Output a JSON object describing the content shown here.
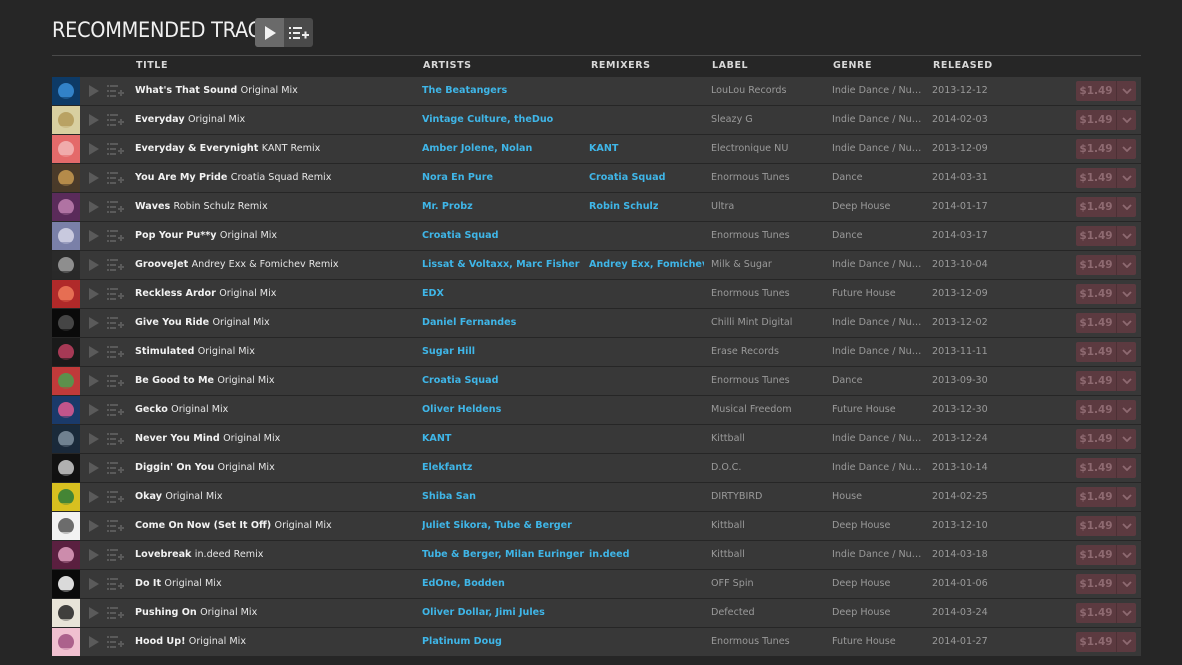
{
  "section": {
    "title": "RECOMMENDED TRACKS"
  },
  "header_buttons": {
    "play_all": "play-icon",
    "add_all_to_queue": "add-to-queue-icon"
  },
  "columns": {
    "title": "TITLE",
    "artists": "ARTISTS",
    "remixers": "REMIXERS",
    "label": "LABEL",
    "genre": "GENRE",
    "released": "RELEASED"
  },
  "colors": {
    "background": "#262626",
    "row": "#383838",
    "link": "#3fb6e8",
    "price_button": "#5c3a40",
    "price_text": "#8e6a71"
  },
  "tracks": [
    {
      "name": "What's That Sound",
      "mix": "Original Mix",
      "artists": "The Beatangers",
      "remixers": "",
      "label": "LouLou Records",
      "genre": "Indie Dance / Nu Disco",
      "released": "2013-12-12",
      "price": "$1.49"
    },
    {
      "name": "Everyday",
      "mix": "Original Mix",
      "artists": "Vintage Culture, theDuo",
      "remixers": "",
      "label": "Sleazy G",
      "genre": "Indie Dance / Nu Disco",
      "released": "2014-02-03",
      "price": "$1.49"
    },
    {
      "name": "Everyday & Everynight",
      "mix": "KANT Remix",
      "artists": "Amber Jolene, Nolan",
      "remixers": "KANT",
      "label": "Electronique NU",
      "genre": "Indie Dance / Nu Disco",
      "released": "2013-12-09",
      "price": "$1.49"
    },
    {
      "name": "You Are My Pride",
      "mix": "Croatia Squad Remix",
      "artists": "Nora En Pure",
      "remixers": "Croatia Squad",
      "label": "Enormous Tunes",
      "genre": "Dance",
      "released": "2014-03-31",
      "price": "$1.49"
    },
    {
      "name": "Waves",
      "mix": "Robin Schulz Remix",
      "artists": "Mr. Probz",
      "remixers": "Robin Schulz",
      "label": "Ultra",
      "genre": "Deep House",
      "released": "2014-01-17",
      "price": "$1.49"
    },
    {
      "name": "Pop Your Pu**y",
      "mix": "Original Mix",
      "artists": "Croatia Squad",
      "remixers": "",
      "label": "Enormous Tunes",
      "genre": "Dance",
      "released": "2014-03-17",
      "price": "$1.49"
    },
    {
      "name": "GrooveJet",
      "mix": "Andrey Exx & Fomichev Remix",
      "artists": "Lissat & Voltaxx, Marc Fisher",
      "remixers": "Andrey Exx, Fomichev",
      "label": "Milk & Sugar",
      "genre": "Indie Dance / Nu Disco",
      "released": "2013-10-04",
      "price": "$1.49"
    },
    {
      "name": "Reckless Ardor",
      "mix": "Original Mix",
      "artists": "EDX",
      "remixers": "",
      "label": "Enormous Tunes",
      "genre": "Future House",
      "released": "2013-12-09",
      "price": "$1.49"
    },
    {
      "name": "Give You Ride",
      "mix": "Original Mix",
      "artists": "Daniel Fernandes",
      "remixers": "",
      "label": "Chilli Mint Digital",
      "genre": "Indie Dance / Nu Disco",
      "released": "2013-12-02",
      "price": "$1.49"
    },
    {
      "name": "Stimulated",
      "mix": "Original Mix",
      "artists": "Sugar Hill",
      "remixers": "",
      "label": "Erase Records",
      "genre": "Indie Dance / Nu Disco",
      "released": "2013-11-11",
      "price": "$1.49"
    },
    {
      "name": "Be Good to Me",
      "mix": "Original Mix",
      "artists": "Croatia Squad",
      "remixers": "",
      "label": "Enormous Tunes",
      "genre": "Dance",
      "released": "2013-09-30",
      "price": "$1.49"
    },
    {
      "name": "Gecko",
      "mix": "Original Mix",
      "artists": "Oliver Heldens",
      "remixers": "",
      "label": "Musical Freedom",
      "genre": "Future House",
      "released": "2013-12-30",
      "price": "$1.49"
    },
    {
      "name": "Never You Mind",
      "mix": "Original Mix",
      "artists": "KANT",
      "remixers": "",
      "label": "Kittball",
      "genre": "Indie Dance / Nu Disco",
      "released": "2013-12-24",
      "price": "$1.49"
    },
    {
      "name": "Diggin' On You",
      "mix": "Original Mix",
      "artists": "Elekfantz",
      "remixers": "",
      "label": "D.O.C.",
      "genre": "Indie Dance / Nu Disco",
      "released": "2013-10-14",
      "price": "$1.49"
    },
    {
      "name": "Okay",
      "mix": "Original Mix",
      "artists": "Shiba San",
      "remixers": "",
      "label": "DIRTYBIRD",
      "genre": "House",
      "released": "2014-02-25",
      "price": "$1.49"
    },
    {
      "name": "Come On Now (Set It Off)",
      "mix": "Original Mix",
      "artists": "Juliet Sikora, Tube & Berger",
      "remixers": "",
      "label": "Kittball",
      "genre": "Deep House",
      "released": "2013-12-10",
      "price": "$1.49"
    },
    {
      "name": "Lovebreak",
      "mix": "in.deed Remix",
      "artists": "Tube & Berger, Milan Euringer",
      "remixers": "in.deed",
      "label": "Kittball",
      "genre": "Indie Dance / Nu Disco",
      "released": "2014-03-18",
      "price": "$1.49"
    },
    {
      "name": "Do It",
      "mix": "Original Mix",
      "artists": "EdOne, Bodden",
      "remixers": "",
      "label": "OFF Spin",
      "genre": "Deep House",
      "released": "2014-01-06",
      "price": "$1.49"
    },
    {
      "name": "Pushing On",
      "mix": "Original Mix",
      "artists": "Oliver Dollar, Jimi Jules",
      "remixers": "",
      "label": "Defected",
      "genre": "Deep House",
      "released": "2014-03-24",
      "price": "$1.49"
    },
    {
      "name": "Hood Up!",
      "mix": "Original Mix",
      "artists": "Platinum Doug",
      "remixers": "",
      "label": "Enormous Tunes",
      "genre": "Future House",
      "released": "2014-01-27",
      "price": "$1.49"
    }
  ]
}
